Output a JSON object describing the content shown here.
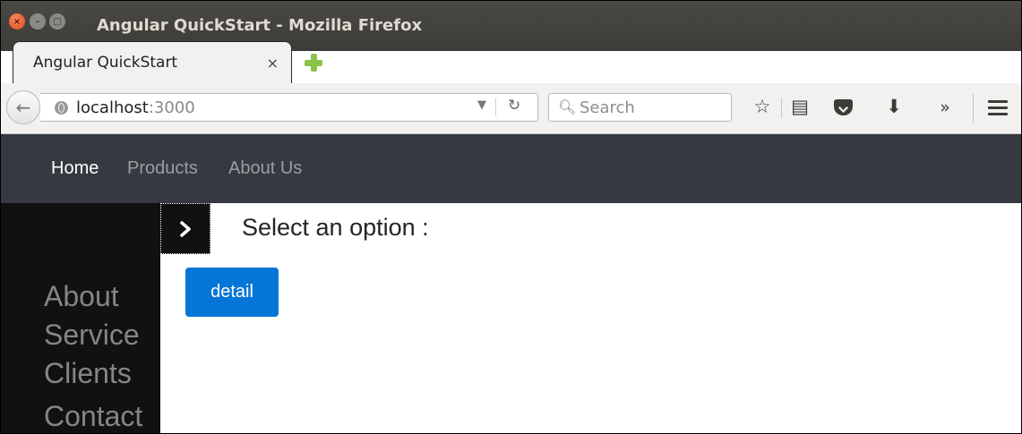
{
  "window": {
    "title": "Angular QuickStart - Mozilla Firefox",
    "close_glyph": "×",
    "minimize_glyph": "–",
    "maximize_glyph": "□"
  },
  "tab": {
    "title": "Angular QuickStart",
    "close_glyph": "×"
  },
  "urlbar": {
    "host": "localhost",
    "port": ":3000"
  },
  "search": {
    "placeholder": "Search"
  },
  "toolbar_icons": [
    "back-icon",
    "globe-icon",
    "dropdown-icon",
    "reload-icon",
    "search-icon",
    "bookmark-star-icon",
    "reading-list-icon",
    "pocket-icon",
    "download-icon",
    "overflow-icon",
    "menu-icon"
  ],
  "app_nav": {
    "items": [
      {
        "label": "Home",
        "active": true
      },
      {
        "label": "Products",
        "active": false
      },
      {
        "label": "About Us",
        "active": false
      }
    ]
  },
  "sidebar": {
    "items": [
      "About",
      "Service",
      "Clients",
      "Contact"
    ]
  },
  "main": {
    "select_label": "Select an option :",
    "detail_button": "detail"
  },
  "colors": {
    "titlebar": "#3c3b37",
    "app_nav_bg": "#343a40",
    "sidebar_bg": "#111111",
    "primary_button": "#0576d7"
  }
}
